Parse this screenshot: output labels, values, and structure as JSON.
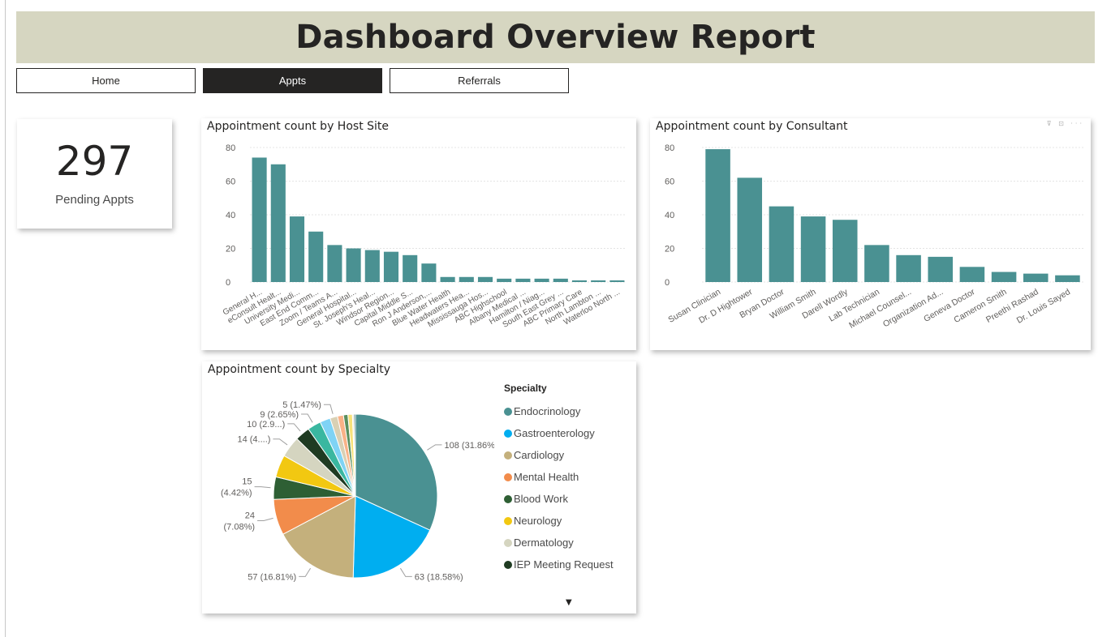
{
  "report_title": "Dashboard Overview Report",
  "nav": [
    {
      "label": "Home",
      "active": false
    },
    {
      "label": "Appts",
      "active": true
    },
    {
      "label": "Referrals",
      "active": false
    }
  ],
  "kpi": {
    "value": "297",
    "label": "Pending Appts"
  },
  "bar_color": "#4a9192",
  "host_site_chart": {
    "title": "Appointment count by Host Site",
    "y_ticks": [
      "80",
      "60",
      "40",
      "20",
      "0"
    ],
    "ylim": [
      0,
      80
    ],
    "categories": [
      "General H...",
      "eConsult Healt...",
      "University Medi...",
      "East End Comm...",
      "Zoom / Teams A...",
      "General Hospital...",
      "St. Joseph's Heal...",
      "Windsor Region...",
      "Capital Middle S...",
      "Ron J Anderson,...",
      "Blue Water Health",
      "Headwaters Hea...",
      "Mississauga Hos...",
      "ABC Highschool",
      "Albany Medical ...",
      "Hamilton / Niag...",
      "South East Grey ...",
      "ABC Primary Care",
      "North Lambton ...",
      "Waterloo North ..."
    ],
    "values": [
      74,
      70,
      39,
      30,
      22,
      20,
      19,
      18,
      16,
      11,
      3,
      3,
      3,
      2,
      2,
      2,
      2,
      1,
      1,
      1
    ]
  },
  "consultant_chart": {
    "title": "Appointment count by Consultant",
    "y_ticks": [
      "80",
      "60",
      "40",
      "20",
      "0"
    ],
    "ylim": [
      0,
      80
    ],
    "categories": [
      "Susan Clinician",
      "Dr. D Hightower",
      "Bryan Doctor",
      "William Smith",
      "Darell Wordly",
      "Lab Technician",
      "Michael Counsel...",
      "Organization Ad...",
      "Geneva Doctor",
      "Cameron Smith",
      "Preethi Rashad",
      "Dr. Louis Sayed"
    ],
    "values": [
      79,
      62,
      45,
      39,
      37,
      22,
      16,
      15,
      9,
      6,
      5,
      4
    ]
  },
  "chart_data": {
    "type": "pie",
    "title": "Appointment count by Specialty",
    "legend_title": "Specialty",
    "legend": [
      {
        "name": "Endocrinology",
        "color": "#4a9192"
      },
      {
        "name": "Gastroenterology",
        "color": "#00aef0"
      },
      {
        "name": "Cardiology",
        "color": "#c4b07c"
      },
      {
        "name": "Mental Health",
        "color": "#f28c4b"
      },
      {
        "name": "Blood Work",
        "color": "#2e5f34"
      },
      {
        "name": "Neurology",
        "color": "#f2c811"
      },
      {
        "name": "Dermatology",
        "color": "#d5d5c0"
      },
      {
        "name": "IEP Meeting Request",
        "color": "#1f3b22"
      }
    ],
    "slices": [
      {
        "value": 108,
        "label": "108 (31.86%)",
        "color": "#4a9192"
      },
      {
        "value": 63,
        "label": "63 (18.58%)",
        "color": "#00aef0"
      },
      {
        "value": 57,
        "label": "57 (16.81%)",
        "color": "#c4b07c"
      },
      {
        "value": 24,
        "label": "24\n(7.08%)",
        "color": "#f28c4b"
      },
      {
        "value": 15,
        "label": "15\n(4.42%)",
        "color": "#2e5f34"
      },
      {
        "value": 15,
        "label": "",
        "color": "#f2c811"
      },
      {
        "value": 14,
        "label": "14 (4....)",
        "color": "#d5d5c0"
      },
      {
        "value": 10,
        "label": "10 (2.9...)",
        "color": "#1f3b22"
      },
      {
        "value": 9,
        "label": "9 (2.65%)",
        "color": "#3ab7a0"
      },
      {
        "value": 7,
        "label": "",
        "color": "#7fd3f5"
      },
      {
        "value": 5,
        "label": "5 (1.47%)",
        "color": "#d9d0b4"
      },
      {
        "value": 4,
        "label": "",
        "color": "#f9b287"
      },
      {
        "value": 3,
        "label": "",
        "color": "#5a8f5e"
      },
      {
        "value": 3,
        "label": "",
        "color": "#f7e27a"
      },
      {
        "value": 1,
        "label": "",
        "color": "#e6e6da"
      },
      {
        "value": 1,
        "label": "",
        "color": "#2f6b70"
      }
    ]
  }
}
